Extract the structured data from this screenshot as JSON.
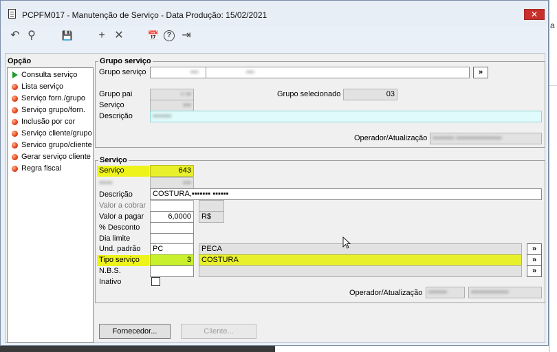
{
  "window": {
    "title": "PCPFM017 - Manutenção de Serviço - Data Produção: 15/02/2021",
    "close_label": "✕"
  },
  "desktop": {
    "side_text": "a"
  },
  "toolbar": {
    "undo_icon": "↶",
    "search_icon": "⚲",
    "save_icon": "💾",
    "add_icon": "+",
    "delete_icon": "✕",
    "calendar_icon": "📅",
    "help_icon": "?",
    "exit_icon": "⇥"
  },
  "options": {
    "title": "Opção",
    "items": [
      {
        "label": "Consulta serviço",
        "active": true
      },
      {
        "label": "Lista serviço"
      },
      {
        "label": "Serviço forn./grupo"
      },
      {
        "label": "Serviço grupo/forn."
      },
      {
        "label": "Inclusão por cor"
      },
      {
        "label": "Serviço cliente/grupo"
      },
      {
        "label": "Servico grupo/cliente"
      },
      {
        "label": "Gerar serviço cliente"
      },
      {
        "label": "Regra fiscal"
      }
    ]
  },
  "grupo": {
    "title": "Grupo serviço",
    "grupo_servico_label": "Grupo serviço",
    "grupo_servico_value1": "▪▪▪",
    "grupo_servico_value2": "▪▪▪",
    "grupo_pai_label": "Grupo pai",
    "grupo_pai_value": "▪ ▪▪",
    "servico_label": "Serviço",
    "servico_value": "▪▪▪",
    "descricao_label": "Descrição",
    "descricao_value": "▪▪▪▪▪▪▪",
    "grupo_selecionado_label": "Grupo selecionado",
    "grupo_selecionado_value": "03",
    "operador_label": "Operador/Atualização",
    "operador_value": "▪▪▪▪▪▪▪▪ ▪▪▪▪▪▪▪▪▪▪▪▪▪▪▪▪▪",
    "more_label": "»"
  },
  "servico": {
    "title": "Serviço",
    "servico_label": "Serviço",
    "servico_value": "643",
    "hidden_label": "▪▪▪▪▪",
    "hidden_value": "▪▪▪",
    "descricao_label": "Descrição",
    "descricao_value": "COSTURA,▪▪▪▪▪▪▪ ▪▪▪▪▪▪",
    "valor_cobrar_label": "Valor a cobrar",
    "valor_pagar_label": "Valor a pagar",
    "valor_pagar_value": "6,0000",
    "currency": "R$",
    "desconto_label": "% Desconto",
    "dia_limite_label": "Dia limite",
    "und_padrao_label": "Und. padrão",
    "und_padrao_code": "PC",
    "und_padrao_desc": "PECA",
    "tipo_servico_label": "Tipo serviço",
    "tipo_servico_code": "3",
    "tipo_servico_desc": "COSTURA",
    "nbs_label": "N.B.S.",
    "inativo_label": "Inativo",
    "operador_label": "Operador/Atualização",
    "operador_value1": "▪▪▪▪▪▪▪",
    "operador_value2": "▪▪▪▪▪▪▪▪▪▪▪▪▪▪",
    "more_label": "»"
  },
  "footer": {
    "fornecedor_label": "Fornecedor...",
    "cliente_label": "Cliente..."
  }
}
